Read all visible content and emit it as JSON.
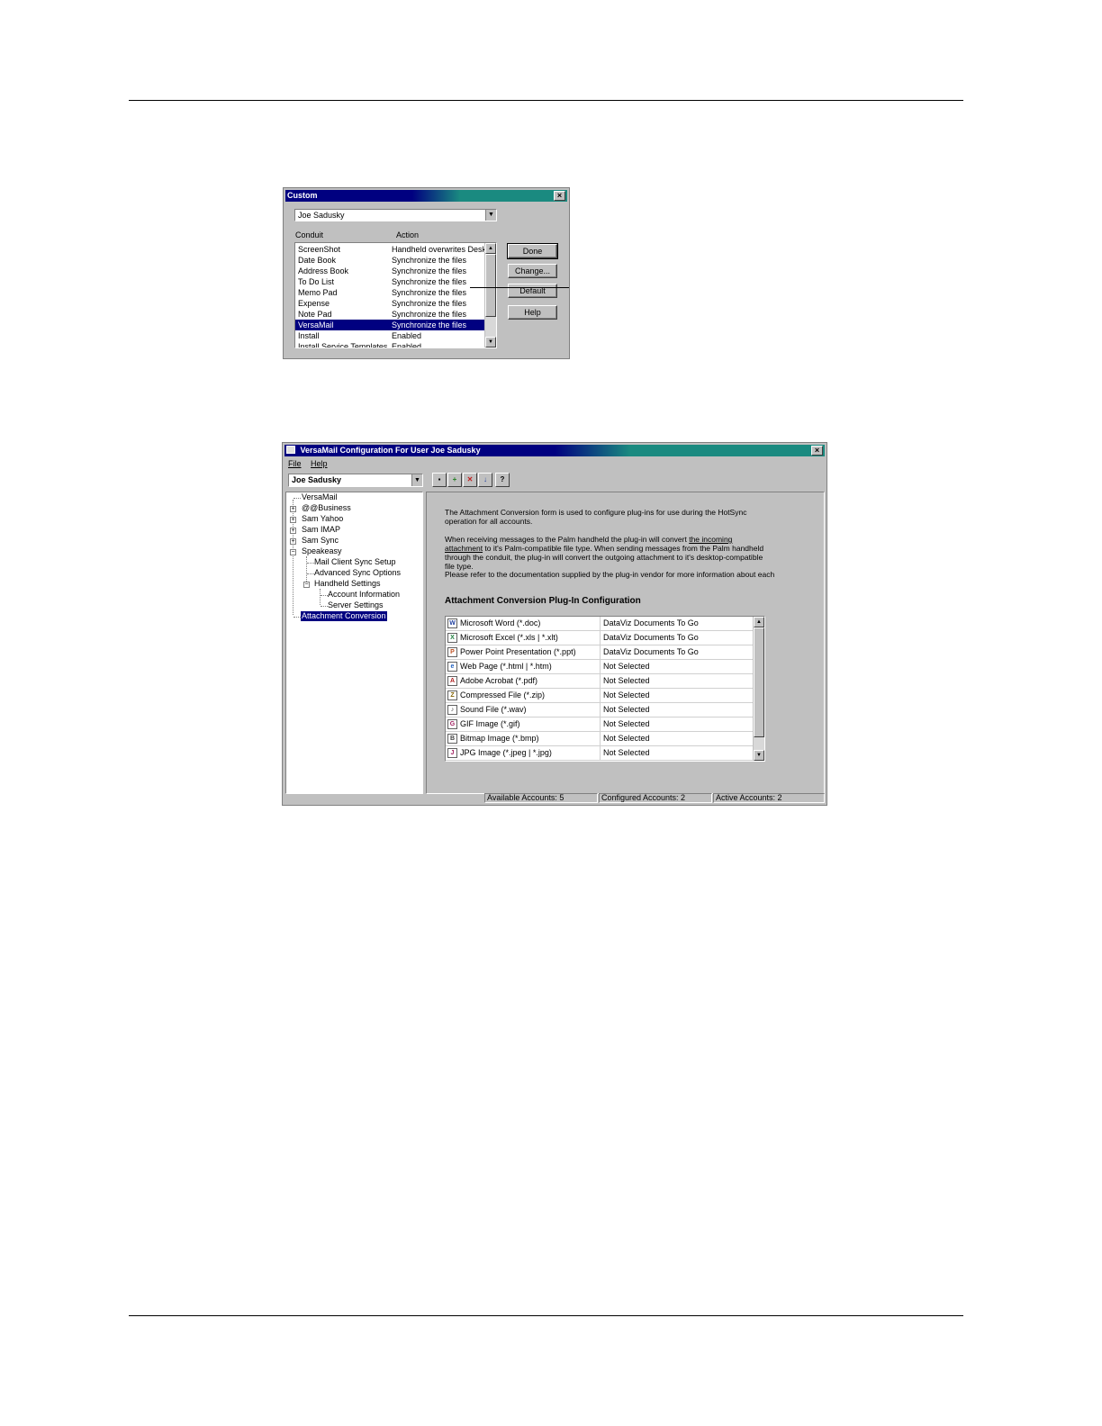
{
  "colors": {
    "title_gradient_start": "#000080",
    "title_gradient_end": "#1a8a80",
    "selection": "#000080",
    "dialog_face": "#c0c0c0"
  },
  "custom_dialog": {
    "title": "Custom",
    "user": "Joe Sadusky",
    "columns": {
      "conduit": "Conduit",
      "action": "Action"
    },
    "rows": [
      {
        "conduit": "ScreenShot",
        "action": "Handheld overwrites Desktop"
      },
      {
        "conduit": "Date Book",
        "action": "Synchronize the files"
      },
      {
        "conduit": "Address Book",
        "action": "Synchronize the files"
      },
      {
        "conduit": "To Do List",
        "action": "Synchronize the files"
      },
      {
        "conduit": "Memo Pad",
        "action": "Synchronize the files"
      },
      {
        "conduit": "Expense",
        "action": "Synchronize the files"
      },
      {
        "conduit": "Note Pad",
        "action": "Synchronize the files"
      },
      {
        "conduit": "VersaMail",
        "action": "Synchronize the files"
      },
      {
        "conduit": "Install",
        "action": "Enabled"
      },
      {
        "conduit": "Install Service Templates",
        "action": "Enabled"
      }
    ],
    "selected_row": 7,
    "buttons": {
      "done": "Done",
      "change": "Change...",
      "default": "Default",
      "help": "Help"
    }
  },
  "versamail_window": {
    "title": "VersaMail Configuration For User Joe Sadusky",
    "menu": {
      "file": "File",
      "help": "Help"
    },
    "user": "Joe Sadusky",
    "toolbar_icons": [
      "save-icon",
      "add-account-icon",
      "delete-account-icon",
      "import-icon",
      "help-icon"
    ],
    "tree": {
      "root": "VersaMail",
      "accounts": [
        "@@Business",
        "Sam Yahoo",
        "Sam IMAP",
        "Sam Sync",
        "Speakeasy"
      ],
      "speakeasy_children": [
        "Mail Client Sync Setup",
        "Advanced Sync Options",
        "Handheld Settings"
      ],
      "handheld_children": [
        "Account Information",
        "Server Settings"
      ],
      "selected": "Attachment Conversion"
    },
    "description": {
      "p1": "The Attachment Conversion form is used to configure plug-ins for use during the HotSync operation for all accounts.",
      "p2_a": "When receiving messages to the Palm handheld the plug-in will convert ",
      "p2_link": "the incoming attachment",
      "p2_b": " to it's Palm-compatible file type. When sending messages from the Palm handheld through the conduit, the plug-in will convert the outgoing attachment to it's desktop-compatible file type.",
      "p3": "Please refer to the documentation supplied by the plug-in vendor for more information about each"
    },
    "section_title": "Attachment Conversion Plug-In Configuration",
    "plugins": [
      {
        "type": "Microsoft Word (*.doc)",
        "plugin": "DataViz Documents To Go",
        "icon": "word-icon",
        "glyph": "W",
        "color": "#2040a0"
      },
      {
        "type": "Microsoft Excel (*.xls | *.xlt)",
        "plugin": "DataViz Documents To Go",
        "icon": "excel-icon",
        "glyph": "X",
        "color": "#208040"
      },
      {
        "type": "Power Point Presentation (*.ppt)",
        "plugin": "DataViz Documents To Go",
        "icon": "powerpoint-icon",
        "glyph": "P",
        "color": "#c05020"
      },
      {
        "type": "Web Page (*.html | *.htm)",
        "plugin": "Not Selected",
        "icon": "web-page-icon",
        "glyph": "e",
        "color": "#2060c0"
      },
      {
        "type": "Adobe Acrobat (*.pdf)",
        "plugin": "Not Selected",
        "icon": "pdf-icon",
        "glyph": "A",
        "color": "#b02020"
      },
      {
        "type": "Compressed File (*.zip)",
        "plugin": "Not Selected",
        "icon": "zip-icon",
        "glyph": "Z",
        "color": "#806000"
      },
      {
        "type": "Sound File (*.wav)",
        "plugin": "Not Selected",
        "icon": "sound-icon",
        "glyph": "♪",
        "color": "#404040"
      },
      {
        "type": "GIF Image (*.gif)",
        "plugin": "Not Selected",
        "icon": "gif-icon",
        "glyph": "G",
        "color": "#a02060"
      },
      {
        "type": "Bitmap Image (*.bmp)",
        "plugin": "Not Selected",
        "icon": "bitmap-icon",
        "glyph": "B",
        "color": "#404040"
      },
      {
        "type": "JPG Image (*.jpeg | *.jpg)",
        "plugin": "Not Selected",
        "icon": "jpg-icon",
        "glyph": "J",
        "color": "#a02060"
      }
    ],
    "status": {
      "available": "Available Accounts: 5",
      "configured": "Configured Accounts: 2",
      "active": "Active Accounts: 2"
    }
  }
}
